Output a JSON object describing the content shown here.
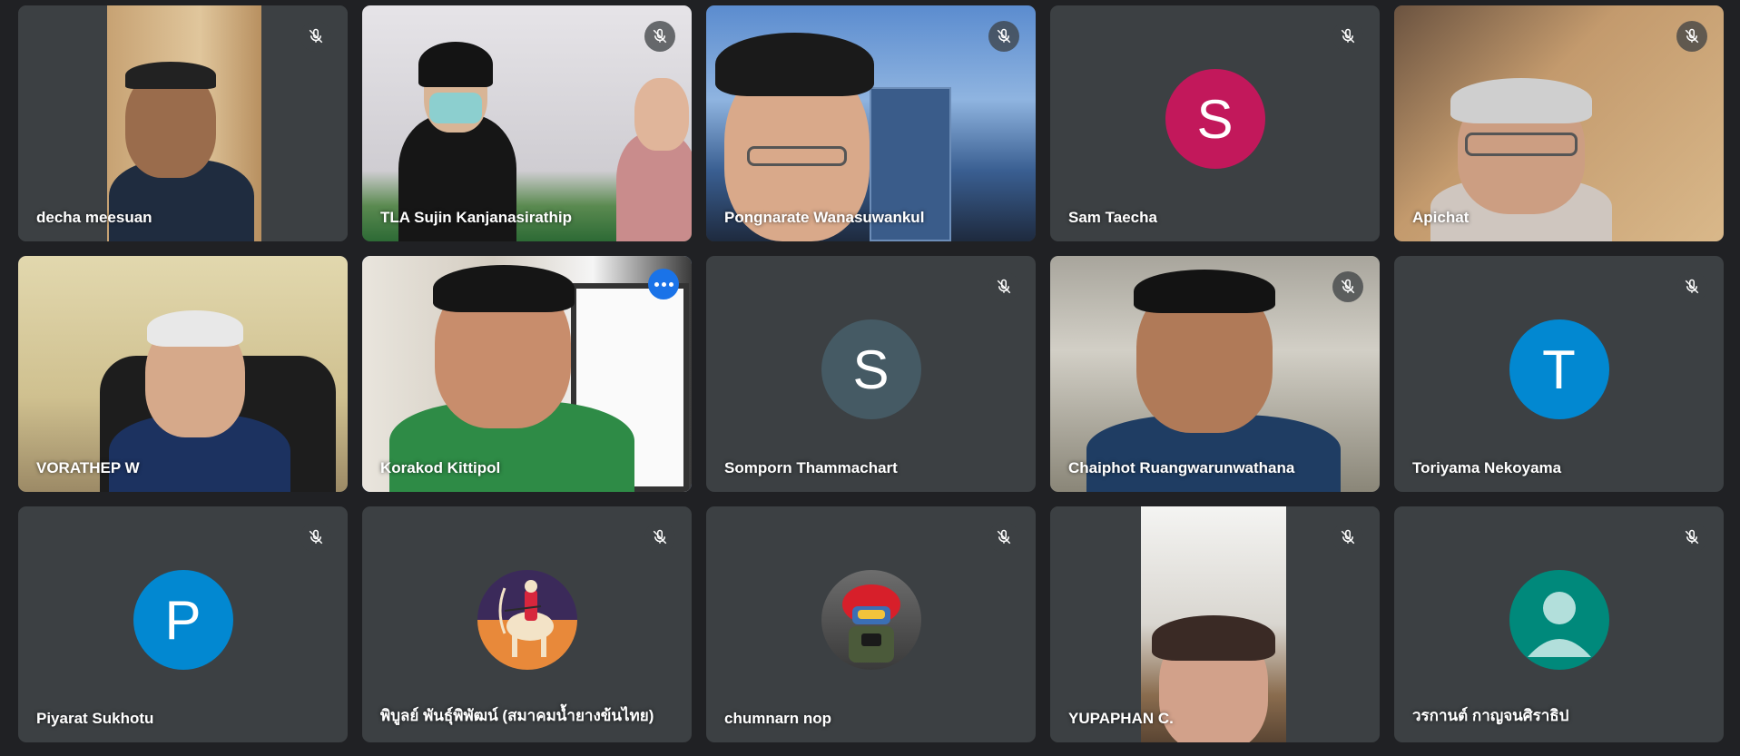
{
  "participants": [
    {
      "name": "decha meesuan",
      "muted": true
    },
    {
      "name": "TLA Sujin Kanjanasirathip",
      "muted": true
    },
    {
      "name": "Pongnarate Wanasuwankul",
      "muted": true
    },
    {
      "name": "Sam Taecha",
      "muted": true,
      "avatar_letter": "S",
      "avatar_color": "#c2185b"
    },
    {
      "name": "Apichat",
      "muted": true
    },
    {
      "name": "VORATHEP W",
      "muted": false
    },
    {
      "name": "Korakod Kittipol",
      "muted": false,
      "active_speaker": true
    },
    {
      "name": "Somporn Thammachart",
      "muted": true,
      "avatar_letter": "S",
      "avatar_color": "#455a64"
    },
    {
      "name": "Chaiphot Ruangwarunwathana",
      "muted": true
    },
    {
      "name": "Toriyama Nekoyama",
      "muted": true,
      "avatar_letter": "T",
      "avatar_color": "#0288d1"
    },
    {
      "name": "Piyarat Sukhotu",
      "muted": true,
      "avatar_letter": "P",
      "avatar_color": "#0288d1"
    },
    {
      "name": "พิบูลย์ พันธุ์พิพัฒน์ (สมาคมน้ำยางข้นไทย)",
      "muted": true
    },
    {
      "name": "chumnarn nop",
      "muted": true
    },
    {
      "name": "YUPAPHAN C.",
      "muted": true
    },
    {
      "name": "วรกานต์ กาญจนศิราธิป",
      "muted": true,
      "avatar_color": "#00897b"
    }
  ],
  "colors": {
    "background": "#202124",
    "tile": "#3c4043",
    "active_outline": "#8ab4f8",
    "more_button": "#1a73e8"
  },
  "icons": {
    "mic_off": "mic-off-icon",
    "more": "more-options-icon",
    "default_avatar": "person-icon"
  }
}
